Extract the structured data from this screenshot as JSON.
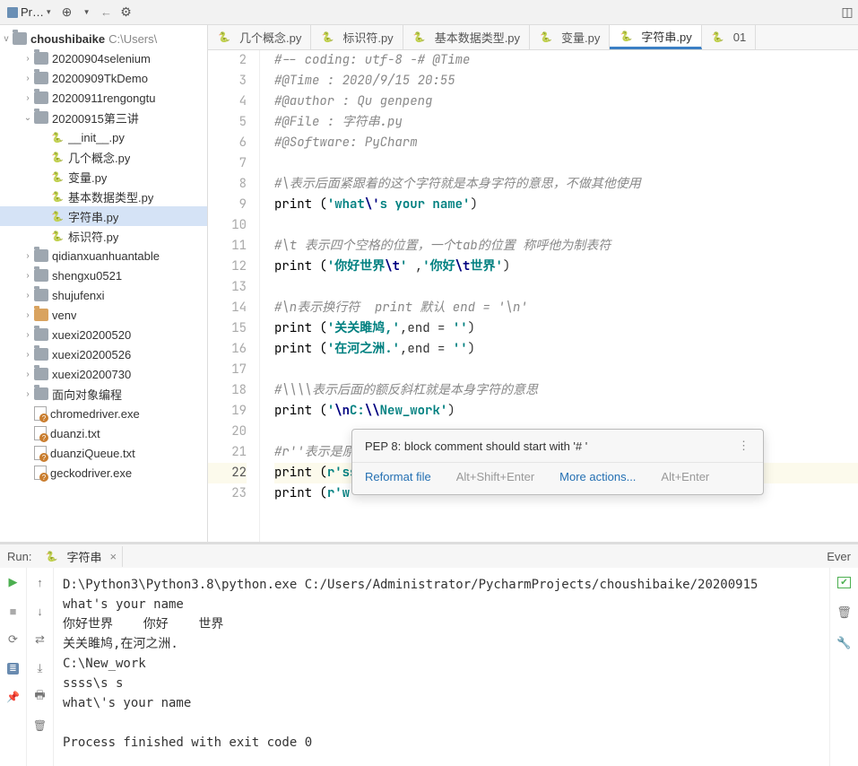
{
  "toolbar": {
    "project_label": "Pr…",
    "dropdown_arrow": "▾"
  },
  "project_root": {
    "name": "choushibaike",
    "path": "C:\\Users\\"
  },
  "tree": [
    {
      "depth": 1,
      "arrow": ">",
      "icon": "folder",
      "label": "20200904selenium"
    },
    {
      "depth": 1,
      "arrow": ">",
      "icon": "folder",
      "label": "20200909TkDemo"
    },
    {
      "depth": 1,
      "arrow": ">",
      "icon": "folder",
      "label": "20200911rengongtu"
    },
    {
      "depth": 1,
      "arrow": "v",
      "icon": "folder",
      "label": "20200915第三讲"
    },
    {
      "depth": 2,
      "arrow": "",
      "icon": "py",
      "label": "__init__.py"
    },
    {
      "depth": 2,
      "arrow": "",
      "icon": "py",
      "label": "几个概念.py"
    },
    {
      "depth": 2,
      "arrow": "",
      "icon": "py",
      "label": "变量.py"
    },
    {
      "depth": 2,
      "arrow": "",
      "icon": "py",
      "label": "基本数据类型.py"
    },
    {
      "depth": 2,
      "arrow": "",
      "icon": "py",
      "label": "字符串.py",
      "selected": true
    },
    {
      "depth": 2,
      "arrow": "",
      "icon": "py",
      "label": "标识符.py"
    },
    {
      "depth": 1,
      "arrow": ">",
      "icon": "folder",
      "label": "qidianxuanhuantable"
    },
    {
      "depth": 1,
      "arrow": ">",
      "icon": "folder",
      "label": "shengxu0521"
    },
    {
      "depth": 1,
      "arrow": ">",
      "icon": "folder",
      "label": "shujufenxi"
    },
    {
      "depth": 1,
      "arrow": ">",
      "icon": "folder-orange",
      "label": "venv"
    },
    {
      "depth": 1,
      "arrow": ">",
      "icon": "folder",
      "label": "xuexi20200520"
    },
    {
      "depth": 1,
      "arrow": ">",
      "icon": "folder",
      "label": "xuexi20200526"
    },
    {
      "depth": 1,
      "arrow": ">",
      "icon": "folder",
      "label": "xuexi20200730"
    },
    {
      "depth": 1,
      "arrow": ">",
      "icon": "folder",
      "label": "面向对象编程"
    },
    {
      "depth": 1,
      "arrow": "",
      "icon": "file",
      "label": "chromedriver.exe"
    },
    {
      "depth": 1,
      "arrow": "",
      "icon": "file",
      "label": "duanzi.txt"
    },
    {
      "depth": 1,
      "arrow": "",
      "icon": "file",
      "label": "duanziQueue.txt"
    },
    {
      "depth": 1,
      "arrow": "",
      "icon": "file",
      "label": "geckodriver.exe"
    }
  ],
  "tabs": [
    {
      "label": "几个概念.py"
    },
    {
      "label": "标识符.py"
    },
    {
      "label": "基本数据类型.py"
    },
    {
      "label": "变量.py"
    },
    {
      "label": "字符串.py",
      "active": true
    },
    {
      "label": "01"
    }
  ],
  "editor": {
    "lines": [
      {
        "n": 2,
        "kind": "comment",
        "t": "#-- coding: utf-8 -# @Time"
      },
      {
        "n": 3,
        "kind": "comment",
        "t": "#@Time : 2020/9/15 20:55"
      },
      {
        "n": 4,
        "kind": "comment",
        "t": "#@author : Qu genpeng"
      },
      {
        "n": 5,
        "kind": "comment",
        "t": "#@File : 字符串.py"
      },
      {
        "n": 6,
        "kind": "comment",
        "t": "#@Software: PyCharm"
      },
      {
        "n": 7,
        "kind": "blank",
        "t": ""
      },
      {
        "n": 8,
        "kind": "comment",
        "t": "#\\表示后面紧跟着的这个字符就是本身字符的意思，不做其他使用"
      },
      {
        "n": 9,
        "kind": "code",
        "pre": "print (",
        "str": "'what\\'s your name'",
        "post": ")"
      },
      {
        "n": 10,
        "kind": "blank",
        "t": ""
      },
      {
        "n": 11,
        "kind": "comment",
        "t": "#\\t 表示四个空格的位置，一个tab的位置 称呼他为制表符"
      },
      {
        "n": 12,
        "kind": "code",
        "pre": "print (",
        "str": "'你好世界\\t'",
        "mid": " ,",
        "str2": "'你好\\t世界'",
        "post": ")"
      },
      {
        "n": 13,
        "kind": "blank",
        "t": ""
      },
      {
        "n": 14,
        "kind": "comment",
        "t": "#\\n表示换行符  print 默认 end = '\\n'"
      },
      {
        "n": 15,
        "kind": "code",
        "pre": "print (",
        "str": "'关关雎鸠,'",
        "mid": ",end = ",
        "str2": "''",
        "post": ")"
      },
      {
        "n": 16,
        "kind": "code",
        "pre": "print (",
        "str": "'在河之洲.'",
        "mid": ",end = ",
        "str2": "''",
        "post": ")"
      },
      {
        "n": 17,
        "kind": "blank",
        "t": ""
      },
      {
        "n": 18,
        "kind": "comment",
        "t": "#\\\\\\\\表示后面的额反斜杠就是本身字符的意思"
      },
      {
        "n": 19,
        "kind": "code",
        "pre": "print (",
        "str": "'\\nC:\\\\New_work'",
        "post": ")"
      },
      {
        "n": 20,
        "kind": "blank",
        "t": ""
      },
      {
        "n": 21,
        "kind": "comment",
        "t": "#r''表示是原始字符串，表示引号中的内容没有其他意思，就是字符本身"
      },
      {
        "n": 22,
        "kind": "code",
        "pre": "print (",
        "str": "r'ssss\\s s'",
        "post": ")",
        "current": true
      },
      {
        "n": 23,
        "kind": "code",
        "pre": "print (",
        "str": "r'w",
        "post": ""
      }
    ]
  },
  "tooltip": {
    "message": "PEP 8: block comment should start with '# '",
    "action1": "Reformat file",
    "shortcut1": "Alt+Shift+Enter",
    "action2": "More actions...",
    "shortcut2": "Alt+Enter"
  },
  "run": {
    "label": "Run:",
    "tab_name": "字符串",
    "side_label": "Ever",
    "console_lines": [
      "D:\\Python3\\Python3.8\\python.exe C:/Users/Administrator/PycharmProjects/choushibaike/20200915",
      "what's your name",
      "你好世界    你好    世界",
      "关关雎鸠,在河之洲.",
      "C:\\New_work",
      "ssss\\s s",
      "what\\'s your name",
      "",
      "Process finished with exit code 0"
    ]
  }
}
